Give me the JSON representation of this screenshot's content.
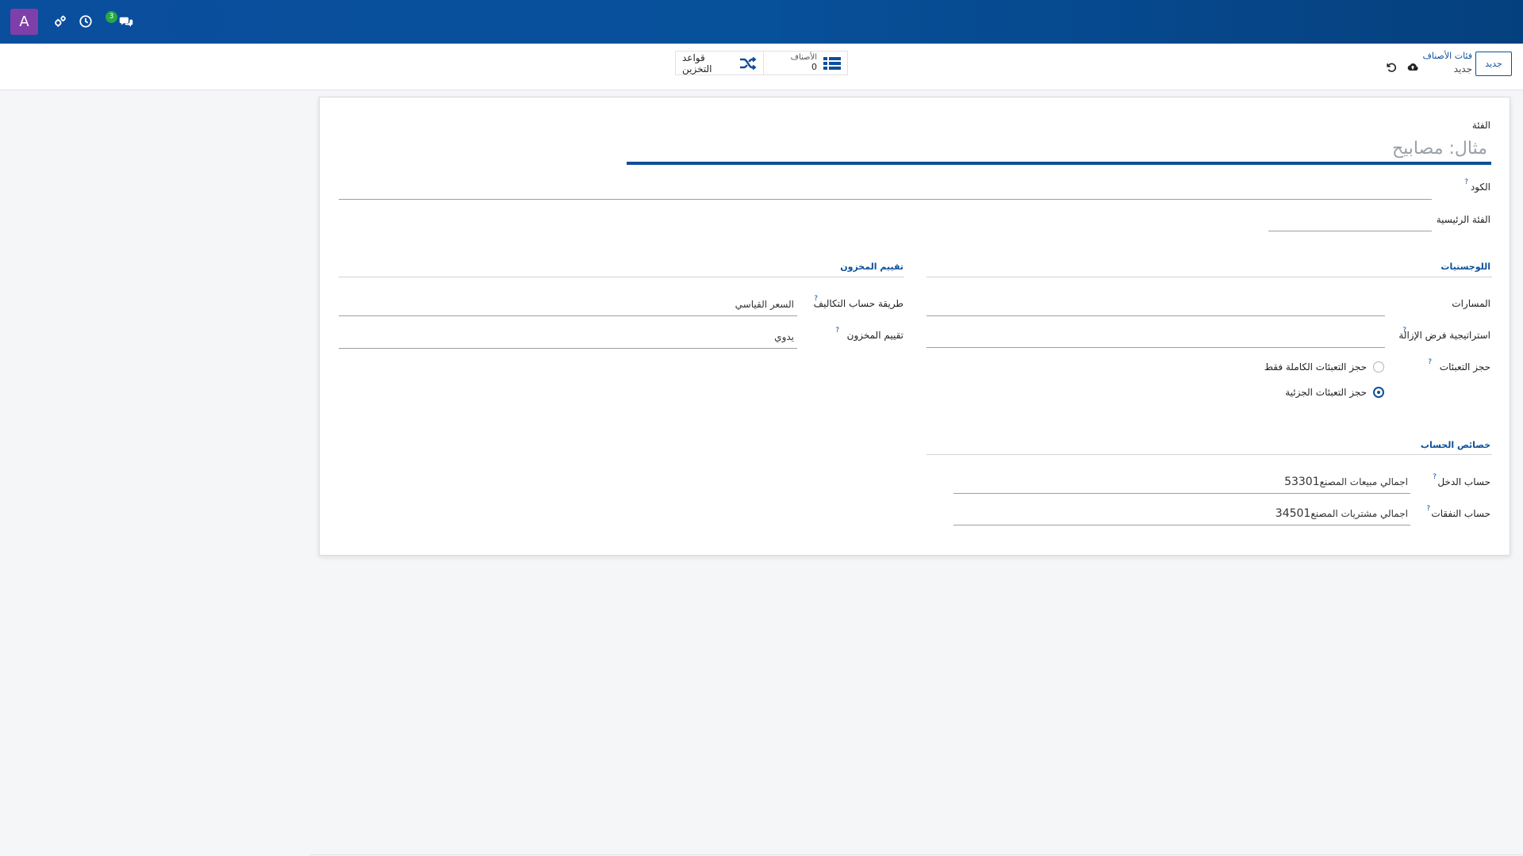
{
  "navbar": {
    "avatar_letter": "A",
    "chat_badge": "3",
    "icons": [
      "gears-icon",
      "clock-icon",
      "chat-icon"
    ]
  },
  "control_panel": {
    "new_button": "جديد",
    "breadcrumb_parent": "فئات الأصناف",
    "breadcrumb_current": "جديد",
    "stat_products_label": "الأصناف",
    "stat_products_value": "0",
    "stat_rules_label": "قواعد التخزين"
  },
  "form": {
    "category_label": "الفئة",
    "category_placeholder": "مثال: مصابيح",
    "code_label": "الكود",
    "parent_category_label": "الفئة الرئيسية",
    "logistics": {
      "title": "اللوجستيات",
      "routes_label": "المسارات",
      "removal_strategy_label": "استراتيجية فرض الإزالة",
      "packaging_reservation_label": "حجز التعبئات",
      "options": [
        "حجز التعبئات الكاملة فقط",
        "حجز التعبئات الجزئية"
      ],
      "selected_option": 1
    },
    "valuation": {
      "title": "تقييم المخزون",
      "costing_method_label": "طريقة حساب التكاليف",
      "costing_method_value": "السعر القياسي",
      "inventory_valuation_label": "تقييم المخزون",
      "inventory_valuation_value": "يدوي"
    },
    "accounts": {
      "title": "خصائص الحساب",
      "income_label": "حساب الدخل",
      "income_code": "53301",
      "income_name": "اجمالي مبيعات المصنع",
      "expense_label": "حساب النفقات",
      "expense_code": "34501",
      "expense_name": "اجمالي مشتريات المصنع"
    }
  },
  "colors": {
    "navbar": "#07509a",
    "accent": "#0d4f9a",
    "avatar": "#7f3fa9",
    "badge": "#28a745"
  }
}
